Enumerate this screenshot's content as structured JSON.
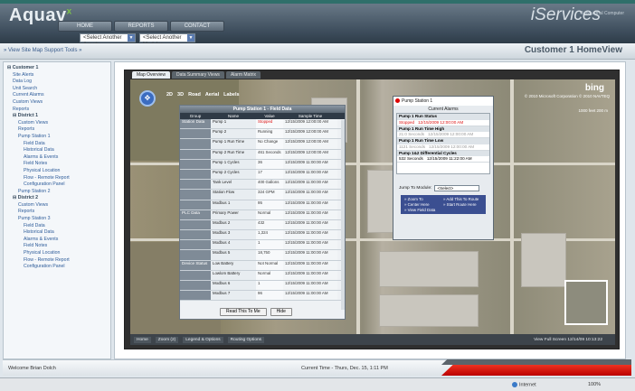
{
  "app": {
    "logo": "Aquav",
    "logo_sup": "x",
    "product": "iServices",
    "product_sub": "© Industrial Computer"
  },
  "topnav": [
    "HOME",
    "REPORTS",
    "CONTACT"
  ],
  "selects": {
    "asset": "<Select Another Asset>",
    "module": "<Select Another Module>"
  },
  "subbar": {
    "links": "» View Site Map   Support Tools »",
    "page_title": "Customer 1 HomeView"
  },
  "sidebar": {
    "items": [
      {
        "label": "Customer 1",
        "indent": 0,
        "section": true
      },
      {
        "label": "Site Alerts",
        "indent": 1
      },
      {
        "label": "Data Log",
        "indent": 1
      },
      {
        "label": "Unit Search",
        "indent": 1
      },
      {
        "label": "Current Alarms",
        "indent": 1
      },
      {
        "label": "Custom Views",
        "indent": 1
      },
      {
        "label": "Reports",
        "indent": 1
      },
      {
        "label": "District 1",
        "indent": 1,
        "section": true
      },
      {
        "label": "Custom Views",
        "indent": 2
      },
      {
        "label": "Reports",
        "indent": 2
      },
      {
        "label": "Pump Station 1",
        "indent": 2
      },
      {
        "label": "Field Data",
        "indent": 3
      },
      {
        "label": "Historical Data",
        "indent": 3
      },
      {
        "label": "Alarms & Events",
        "indent": 3
      },
      {
        "label": "Field Notes",
        "indent": 3
      },
      {
        "label": "Physical Location",
        "indent": 3
      },
      {
        "label": "Flow - Remote Report",
        "indent": 3
      },
      {
        "label": "Configuration Panel",
        "indent": 3
      },
      {
        "label": "Pump Station 2",
        "indent": 2
      },
      {
        "label": "District 2",
        "indent": 1,
        "section": true
      },
      {
        "label": "Custom Views",
        "indent": 2
      },
      {
        "label": "Reports",
        "indent": 2
      },
      {
        "label": "Pump Station 3",
        "indent": 2
      },
      {
        "label": "Field Data",
        "indent": 3
      },
      {
        "label": "Historical Data",
        "indent": 3
      },
      {
        "label": "Alarms & Events",
        "indent": 3
      },
      {
        "label": "Field Notes",
        "indent": 3
      },
      {
        "label": "Physical Location",
        "indent": 3
      },
      {
        "label": "Flow - Remote Report",
        "indent": 3
      },
      {
        "label": "Configuration Panel",
        "indent": 3
      }
    ]
  },
  "map": {
    "tabs": [
      "Map Overview",
      "Data Summary Views",
      "Alarm Matrix"
    ],
    "modes": [
      "2D",
      "3D",
      "Road",
      "Aerial",
      "Labels"
    ],
    "bing": "bing",
    "copyright": "© 2010 Microsoft Corporation  © 2010 NAVTEQ",
    "scale": "1000 feet  200 m",
    "statusbar": [
      "Home",
      "Zoom (2)",
      "Legend & Options",
      "Routing Options"
    ],
    "statusbar_right": "View Full Screen     12/14/09  10:13:22"
  },
  "detail": {
    "title": "Pump Station 1 - Field Data",
    "headers": [
      "Group",
      "Name",
      "Value",
      "Sample Time"
    ],
    "rows": [
      {
        "group": "Station Data",
        "name": "Pump 1",
        "value": "Stopped",
        "time": "12/15/2009 12:00:00 AM",
        "alarm": true
      },
      {
        "group": "",
        "name": "Pump 2",
        "value": "Running",
        "time": "12/15/2009 12:00:00 AM"
      },
      {
        "group": "",
        "name": "Pump 1 Run Time",
        "value": "No Change",
        "time": "12/15/2009 12:00:00 AM"
      },
      {
        "group": "",
        "name": "Pump 2 Run Time",
        "value": "461 Seconds",
        "time": "12/15/2009 12:00:00 AM"
      },
      {
        "group": "",
        "name": "Pump 1 Cycles",
        "value": "36",
        "time": "12/15/2009 11:00:00 AM"
      },
      {
        "group": "",
        "name": "Pump 2 Cycles",
        "value": "17",
        "time": "12/15/2009 11:00:00 AM"
      },
      {
        "group": "",
        "name": "Tank Level",
        "value": "400 Gallons",
        "time": "12/15/2009 11:00:00 AM"
      },
      {
        "group": "",
        "name": "Station Flow",
        "value": "324 GPM",
        "time": "12/15/2009 11:00:00 AM"
      },
      {
        "group": "",
        "name": "Modbus 1",
        "value": "95",
        "time": "12/15/2009 11:00:00 AM"
      },
      {
        "group": "PLC Data",
        "name": "Primary Power",
        "value": "Normal",
        "time": "12/15/2009 11:00:00 AM"
      },
      {
        "group": "",
        "name": "Modbus 2",
        "value": "432",
        "time": "12/15/2009 11:00:00 AM"
      },
      {
        "group": "",
        "name": "Modbus 3",
        "value": "1,324",
        "time": "12/15/2009 11:00:00 AM"
      },
      {
        "group": "",
        "name": "Modbus 4",
        "value": "1",
        "time": "12/15/2009 11:00:00 AM"
      },
      {
        "group": "",
        "name": "Modbus 5",
        "value": "18,750",
        "time": "12/15/2009 11:00:00 AM"
      },
      {
        "group": "Device Status",
        "name": "Low Battery",
        "value": "Not Normal",
        "time": "12/15/2009 11:00:00 AM"
      },
      {
        "group": "",
        "name": "Lowlom Battery",
        "value": "Normal",
        "time": "12/15/2009 11:00:00 AM"
      },
      {
        "group": "",
        "name": "Modbus 6",
        "value": "1",
        "time": "12/15/2009 11:00:00 AM"
      },
      {
        "group": "",
        "name": "Modbus 7",
        "value": "96",
        "time": "12/15/2009 11:00:00 AM"
      }
    ],
    "btn_read": "Read This To Me",
    "btn_hide": "Hide"
  },
  "alarm_panel": {
    "station": "Pump Station 1",
    "title": "Current Alarms",
    "items": [
      {
        "name": "Pump 1 Run Status",
        "value": "Stopped",
        "time": "12/15/2009 12:00:00 AM",
        "color": "red"
      },
      {
        "name": "Pump 1 Run Time High",
        "value": "21:0 Seconds",
        "time": "12/15/2009 12:00:00 AM",
        "color": "gray"
      },
      {
        "name": "Pump 1 Run Time Low",
        "value": "1121 Seconds",
        "time": "12/15/2009 12:00:00 AM",
        "color": "gray"
      },
      {
        "name": "Pump 1&2 Differential Cycles",
        "value": "532 Seconds",
        "time": "12/15/2009 11:22:00 AM",
        "color": "normal"
      }
    ],
    "jump_label": "Jump To Module:",
    "jump_value": "<Select>",
    "actions": [
      "» Zoom To",
      "» Add This To Route",
      "» Center Here",
      "» Start Route Here",
      "» View Field Data"
    ]
  },
  "footer": {
    "welcome": "Welcome Brian Dolch",
    "current_time": "Current Time - Thurs, Dec. 15, 1:11 PM"
  },
  "winstatus": {
    "internet": "Internet",
    "zoom": "100%"
  }
}
